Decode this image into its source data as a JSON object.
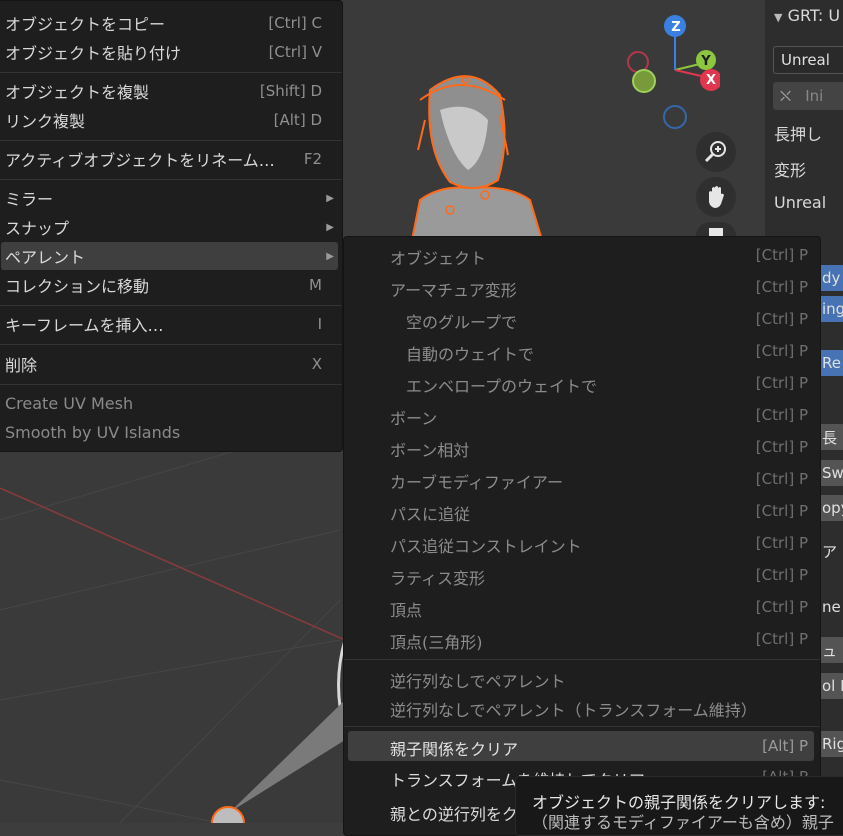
{
  "context_menu": {
    "items": [
      {
        "label": "オブジェクトをコピー",
        "shortcut": "[Ctrl] C"
      },
      {
        "label": "オブジェクトを貼り付け",
        "shortcut": "[Ctrl] V"
      },
      {
        "label": "オブジェクトを複製",
        "shortcut": "[Shift] D"
      },
      {
        "label": "リンク複製",
        "shortcut": "[Alt] D"
      },
      {
        "label": "アクティブオブジェクトをリネーム…",
        "shortcut": "F2"
      },
      {
        "label": "ミラー",
        "shortcut": ""
      },
      {
        "label": "スナップ",
        "shortcut": ""
      },
      {
        "label": "ペアレント",
        "shortcut": ""
      },
      {
        "label": "コレクションに移動",
        "shortcut": "M"
      },
      {
        "label": "キーフレームを挿入…",
        "shortcut": "I"
      },
      {
        "label": "削除",
        "shortcut": "X"
      },
      {
        "label": "Create UV Mesh",
        "shortcut": ""
      },
      {
        "label": "Smooth by UV Islands",
        "shortcut": ""
      }
    ],
    "submenu_arrow": "▶"
  },
  "parent_menu": {
    "items": [
      {
        "label": "オブジェクト",
        "shortcut": "[Ctrl] P"
      },
      {
        "label": "アーマチュア変形",
        "shortcut": "[Ctrl] P"
      },
      {
        "label": "空のグループで",
        "shortcut": "[Ctrl] P"
      },
      {
        "label": "自動のウェイトで",
        "shortcut": "[Ctrl] P"
      },
      {
        "label": "エンベロープのウェイトで",
        "shortcut": "[Ctrl] P"
      },
      {
        "label": "ボーン",
        "shortcut": "[Ctrl] P"
      },
      {
        "label": "ボーン相対",
        "shortcut": "[Ctrl] P"
      },
      {
        "label": "カーブモディファイアー",
        "shortcut": "[Ctrl] P"
      },
      {
        "label": "パスに追従",
        "shortcut": "[Ctrl] P"
      },
      {
        "label": "パス追従コンストレイント",
        "shortcut": "[Ctrl] P"
      },
      {
        "label": "ラティス変形",
        "shortcut": "[Ctrl] P"
      },
      {
        "label": "頂点",
        "shortcut": "[Ctrl] P"
      },
      {
        "label": "頂点(三角形)",
        "shortcut": "[Ctrl] P"
      },
      {
        "label": "逆行列なしでペアレント",
        "shortcut": ""
      },
      {
        "label": "逆行列なしでペアレント（トランスフォーム維持）",
        "shortcut": ""
      },
      {
        "label": "親子関係をクリア",
        "shortcut": "[Alt] P"
      },
      {
        "label": "トランスフォームを維持してクリア",
        "shortcut": "[Alt] P"
      },
      {
        "label": "親との逆行列をクリア",
        "shortcut": ""
      }
    ]
  },
  "tooltip": {
    "line1": "オブジェクトの親子関係をクリアします:",
    "line2": "（関連するモディファイアーも含め）親子"
  },
  "gizmo": {
    "z": "Z",
    "y": "Y",
    "x": "X"
  },
  "right_panel": {
    "header": "GRT: U",
    "dropdown": "Unreal",
    "init_button": "Ini",
    "long_press": "長押し",
    "transform": "変形",
    "unreal": "Unreal",
    "cut_buttons": [
      "dy",
      "ing",
      "Re",
      "長",
      "Sw",
      "opy",
      "ア",
      "ne",
      "ュ",
      "ol R",
      "Rig"
    ]
  },
  "colors": {
    "accent_blue": "#4772b3",
    "highlight": "#3f3f3f",
    "menu_bg": "#1e1e1e",
    "selection_orange": "#ff6a1a"
  }
}
